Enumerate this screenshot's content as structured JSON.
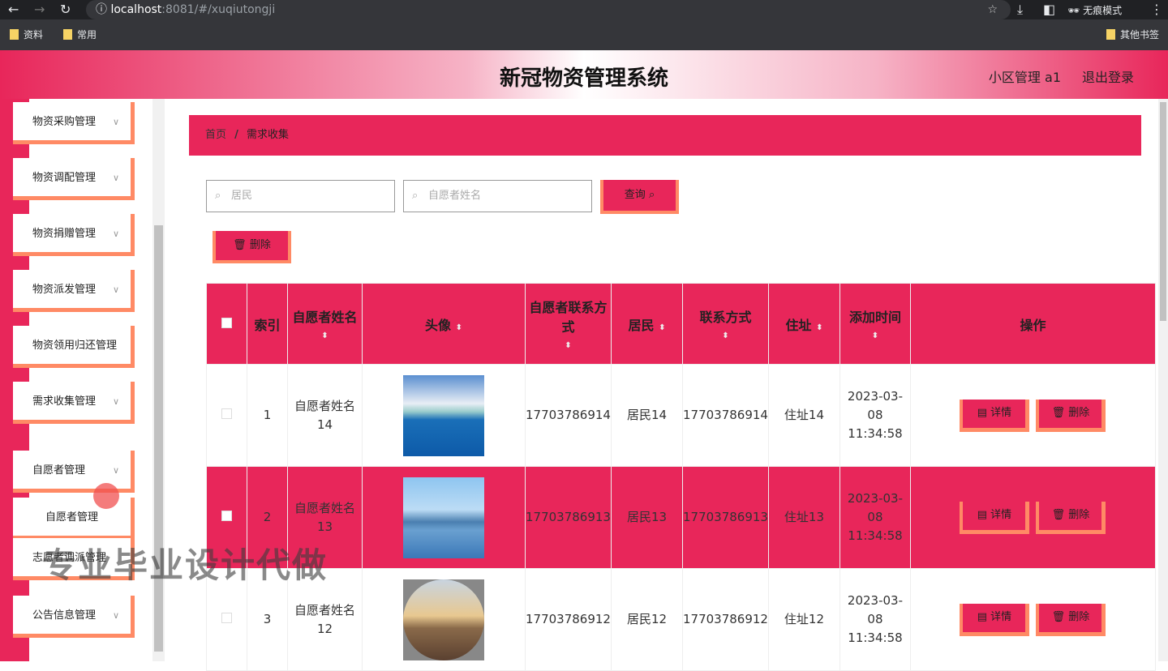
{
  "browser": {
    "url_host": "localhost",
    "url_rest": ":8081/#/xuqiutongji",
    "incognito": "无痕模式",
    "bookmarks": [
      "资料",
      "常用"
    ],
    "other_bookmarks": "其他书签"
  },
  "header": {
    "title": "新冠物资管理系统",
    "user": "小区管理 a1",
    "logout": "退出登录"
  },
  "sidebar": {
    "items": [
      "物资采购管理",
      "物资调配管理",
      "物资捐赠管理",
      "物资派发管理",
      "物资领用归还管理",
      "需求收集管理",
      "自愿者管理"
    ],
    "sub_items": [
      "自愿者管理",
      "志愿者调派管理"
    ],
    "last": "公告信息管理"
  },
  "breadcrumb": {
    "home": "首页",
    "sep": "/",
    "current": "需求收集"
  },
  "search": {
    "resident_placeholder": "居民",
    "volunteer_placeholder": "自愿者姓名",
    "query": "查询",
    "delete": "删除"
  },
  "table": {
    "headers": [
      "索引",
      "自愿者姓名",
      "头像",
      "自愿者联系方式",
      "居民",
      "联系方式",
      "住址",
      "添加时间",
      "操作"
    ],
    "rows": [
      {
        "index": "1",
        "name": "自愿者姓名14",
        "phone": "17703786914",
        "resident": "居民14",
        "contact": "17703786914",
        "address": "住址14",
        "time": "2023-03-08 11:34:58"
      },
      {
        "index": "2",
        "name": "自愿者姓名13",
        "phone": "17703786913",
        "resident": "居民13",
        "contact": "17703786913",
        "address": "住址13",
        "time": "2023-03-08 11:34:58"
      },
      {
        "index": "3",
        "name": "自愿者姓名12",
        "phone": "17703786912",
        "resident": "居民12",
        "contact": "17703786912",
        "address": "住址12",
        "time": "2023-03-08 11:34:58"
      }
    ],
    "detail": "详情",
    "delete": "删除"
  },
  "watermark": "专业毕业设计代做"
}
